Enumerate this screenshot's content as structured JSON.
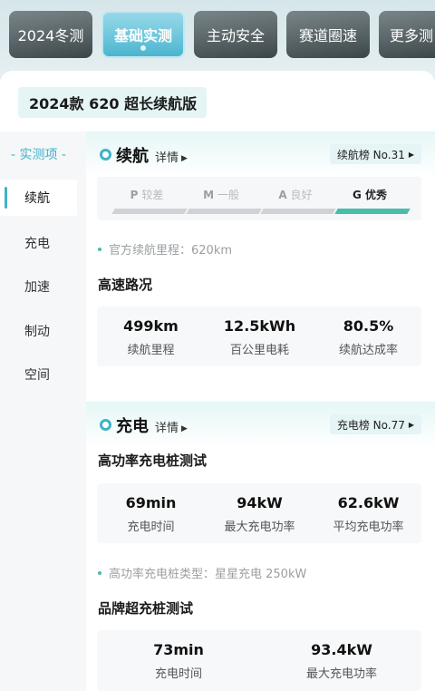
{
  "tabs": [
    {
      "label": "2024冬测"
    },
    {
      "label": "基础实测"
    },
    {
      "label": "主动安全"
    },
    {
      "label": "赛道圈速"
    },
    {
      "label": "更多测"
    }
  ],
  "model": "2024款 620 超长续航版",
  "nav": {
    "header": "- 实测项 -",
    "items": [
      "续航",
      "充电",
      "加速",
      "制动",
      "空间"
    ]
  },
  "range": {
    "title": "续航",
    "detail": "详情",
    "rank": "续航榜 No.31",
    "rating": [
      {
        "grade": "P",
        "text": "较差"
      },
      {
        "grade": "M",
        "text": "一般"
      },
      {
        "grade": "A",
        "text": "良好"
      },
      {
        "grade": "G",
        "text": "优秀"
      }
    ],
    "official_note": "官方续航里程：620km",
    "highway_title": "高速路况",
    "stats": [
      {
        "value": "499km",
        "label": "续航里程"
      },
      {
        "value": "12.5kWh",
        "label": "百公里电耗"
      },
      {
        "value": "80.5%",
        "label": "续航达成率"
      }
    ]
  },
  "charge": {
    "title": "充电",
    "detail": "详情",
    "rank": "充电榜 No.77",
    "high_power_title": "高功率充电桩测试",
    "high_power_stats": [
      {
        "value": "69min",
        "label": "充电时间"
      },
      {
        "value": "94kW",
        "label": "最大充电功率"
      },
      {
        "value": "62.6kW",
        "label": "平均充电功率"
      }
    ],
    "pile_note": "高功率充电桩类型：星星充电 250kW",
    "brand_title": "品牌超充桩测试",
    "brand_stats": [
      {
        "value": "73min",
        "label": "充电时间"
      },
      {
        "value": "93.4kW",
        "label": "最大充电功率"
      }
    ]
  },
  "colors": {
    "accent": "#3fb3c7",
    "good": "#4abcaa"
  }
}
